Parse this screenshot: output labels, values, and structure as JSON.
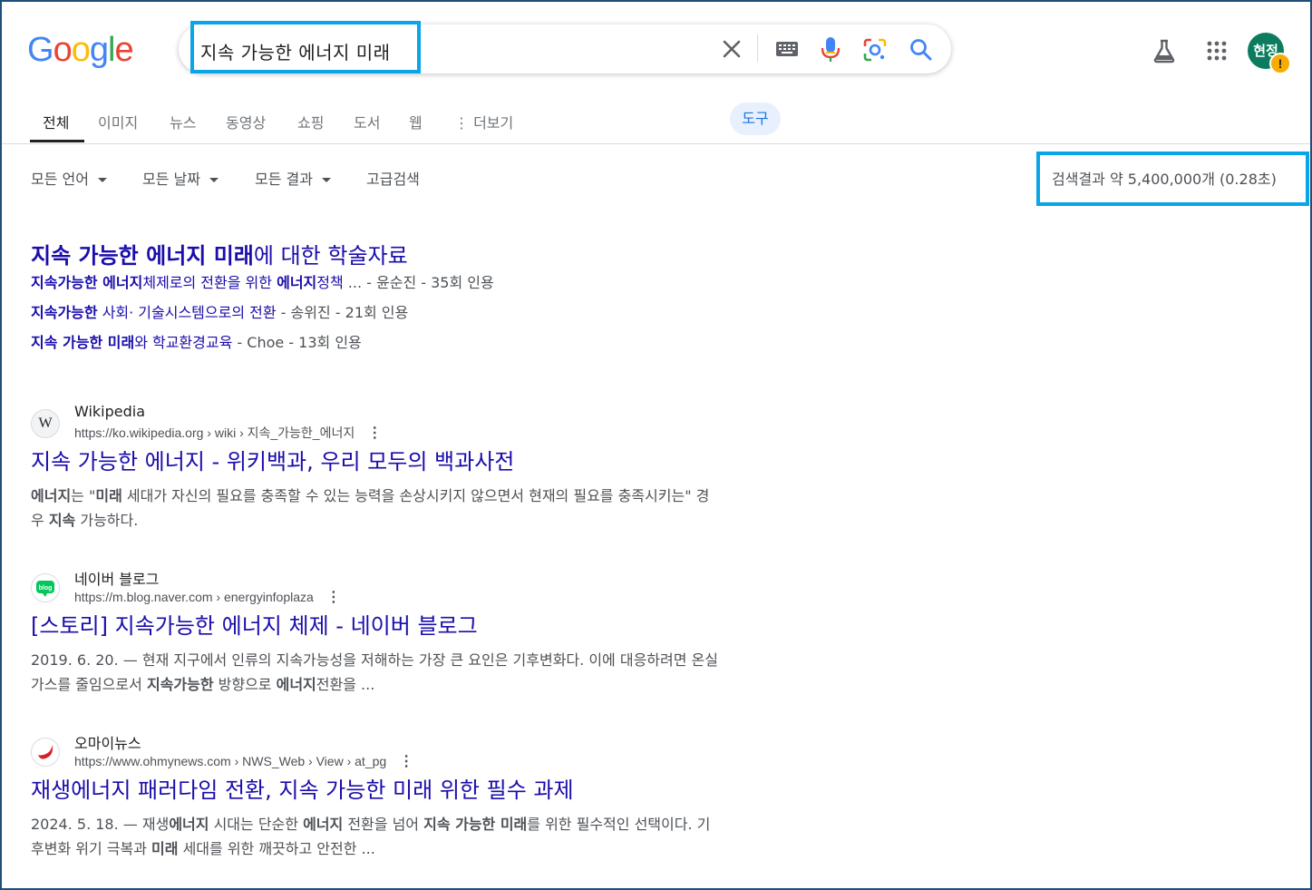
{
  "header": {
    "logo": [
      "G",
      "o",
      "o",
      "g",
      "l",
      "e"
    ],
    "logo_colors": [
      "#4285F4",
      "#EA4335",
      "#FBBC05",
      "#4285F4",
      "#34A853",
      "#EA4335"
    ],
    "search_query": "지속 가능한 에너지 미래",
    "avatar_initials": "현정",
    "avatar_badge": "!"
  },
  "tabs": {
    "items": [
      "전체",
      "이미지",
      "뉴스",
      "동영상",
      "쇼핑",
      "도서",
      "웹",
      "⋮ 더보기"
    ],
    "active": "전체",
    "tools": "도구"
  },
  "filters": {
    "language": "모든 언어",
    "date": "모든 날짜",
    "results": "모든 결과",
    "advanced": "고급검색",
    "result_stats": "검색결과 약 5,400,000개 (0.28초)"
  },
  "scholar": {
    "title_bold": "지속 가능한 에너지 미래",
    "title_rest": "에 대한 학술자료",
    "items": [
      {
        "bold1": "지속가능한 에너지",
        "plain1": "체제로의 전환을 위한 ",
        "bold2": "에너지",
        "plain2": "정책",
        "meta": " ... - 윤순진 - 35회 인용"
      },
      {
        "bold1": "지속가능한",
        "plain1": " 사회· 기술시스템으로의 전환",
        "bold2": "",
        "plain2": "",
        "meta": " - 송위진 - 21회 인용"
      },
      {
        "bold1": "지속 가능한 미래",
        "plain1": "와 학교환경교육",
        "bold2": "",
        "plain2": "",
        "meta": " - Choe - 13회 인용"
      }
    ]
  },
  "results": [
    {
      "site": "Wikipedia",
      "url": "https://ko.wikipedia.org › wiki › 지속_가능한_에너지",
      "favicon": "W",
      "title": "지속 가능한 에너지 - 위키백과, 우리 모두의 백과사전",
      "snippet": [
        {
          "b": "에너지"
        },
        {
          "t": "는 \""
        },
        {
          "b": "미래"
        },
        {
          "t": " 세대가 자신의 필요를 충족할 수 있는 능력을 손상시키지 않으면서 현재의 필요를 충족시키는\" 경우 "
        },
        {
          "b": "지속"
        },
        {
          "t": " 가능하다."
        }
      ]
    },
    {
      "site": "네이버 블로그",
      "url": "https://m.blog.naver.com › energyinfoplaza",
      "favicon": "blog",
      "title": "[스토리] 지속가능한 에너지 체제 - 네이버 블로그",
      "snippet": [
        {
          "t": "2019. 6. 20. — 현재 지구에서 인류의 지속가능성을 저해하는 가장 큰 요인은 기후변화다. 이에 대응하려면 온실가스를 줄임으로서 "
        },
        {
          "b": "지속가능한"
        },
        {
          "t": " 방향으로 "
        },
        {
          "b": "에너지"
        },
        {
          "t": "전환을 ..."
        }
      ]
    },
    {
      "site": "오마이뉴스",
      "url": "https://www.ohmynews.com › NWS_Web › View › at_pg",
      "favicon": "ohmy",
      "title": "재생에너지 패러다임 전환, 지속 가능한 미래 위한 필수 과제",
      "snippet": [
        {
          "t": "2024. 5. 18. — 재생"
        },
        {
          "b": "에너지"
        },
        {
          "t": " 시대는 단순한 "
        },
        {
          "b": "에너지"
        },
        {
          "t": " 전환을 넘어 "
        },
        {
          "b": "지속 가능한 미래"
        },
        {
          "t": "를 위한 필수적인 선택이다. 기후변화 위기 극복과 "
        },
        {
          "b": "미래"
        },
        {
          "t": " 세대를 위한 깨끗하고 안전한 ..."
        }
      ]
    }
  ]
}
